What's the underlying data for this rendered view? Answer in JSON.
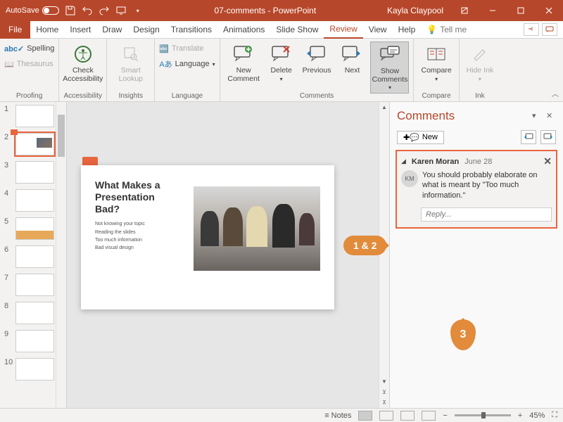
{
  "titlebar": {
    "autosave_label": "AutoSave",
    "doc_title": "07-comments - PowerPoint",
    "user_name": "Kayla Claypool"
  },
  "tabs": {
    "file": "File",
    "home": "Home",
    "insert": "Insert",
    "draw": "Draw",
    "design": "Design",
    "transitions": "Transitions",
    "animations": "Animations",
    "slideshow": "Slide Show",
    "review": "Review",
    "view": "View",
    "help": "Help",
    "tellme": "Tell me"
  },
  "ribbon": {
    "proofing": {
      "label": "Proofing",
      "spelling": "Spelling",
      "thesaurus": "Thesaurus"
    },
    "accessibility": {
      "label": "Accessibility",
      "check": "Check Accessibility"
    },
    "insights": {
      "label": "Insights",
      "smart": "Smart Lookup"
    },
    "language": {
      "label": "Language",
      "translate": "Translate",
      "language": "Language"
    },
    "comments": {
      "label": "Comments",
      "new": "New Comment",
      "delete": "Delete",
      "previous": "Previous",
      "next": "Next",
      "show": "Show Comments"
    },
    "compare": {
      "label": "Compare",
      "compare": "Compare"
    },
    "ink": {
      "label": "Ink",
      "hide": "Hide Ink"
    }
  },
  "thumbs": {
    "numbers": [
      "1",
      "2",
      "3",
      "4",
      "5",
      "6",
      "7",
      "8",
      "9",
      "10"
    ]
  },
  "slide": {
    "title": "What Makes a Presentation Bad?",
    "bullets": [
      "Not knowing your topic",
      "Reading the slides",
      "Too much information",
      "Bad visual design"
    ]
  },
  "comments_pane": {
    "title": "Comments",
    "new_btn": "New",
    "comment": {
      "author": "Karen Moran",
      "date": "June 28",
      "initials": "KM",
      "text": "You should probably elaborate on what is meant by \"Too much information.\""
    },
    "reply_placeholder": "Reply..."
  },
  "callouts": {
    "one_two": "1 & 2",
    "three": "3"
  },
  "statusbar": {
    "notes": "Notes",
    "zoom": "45%"
  }
}
